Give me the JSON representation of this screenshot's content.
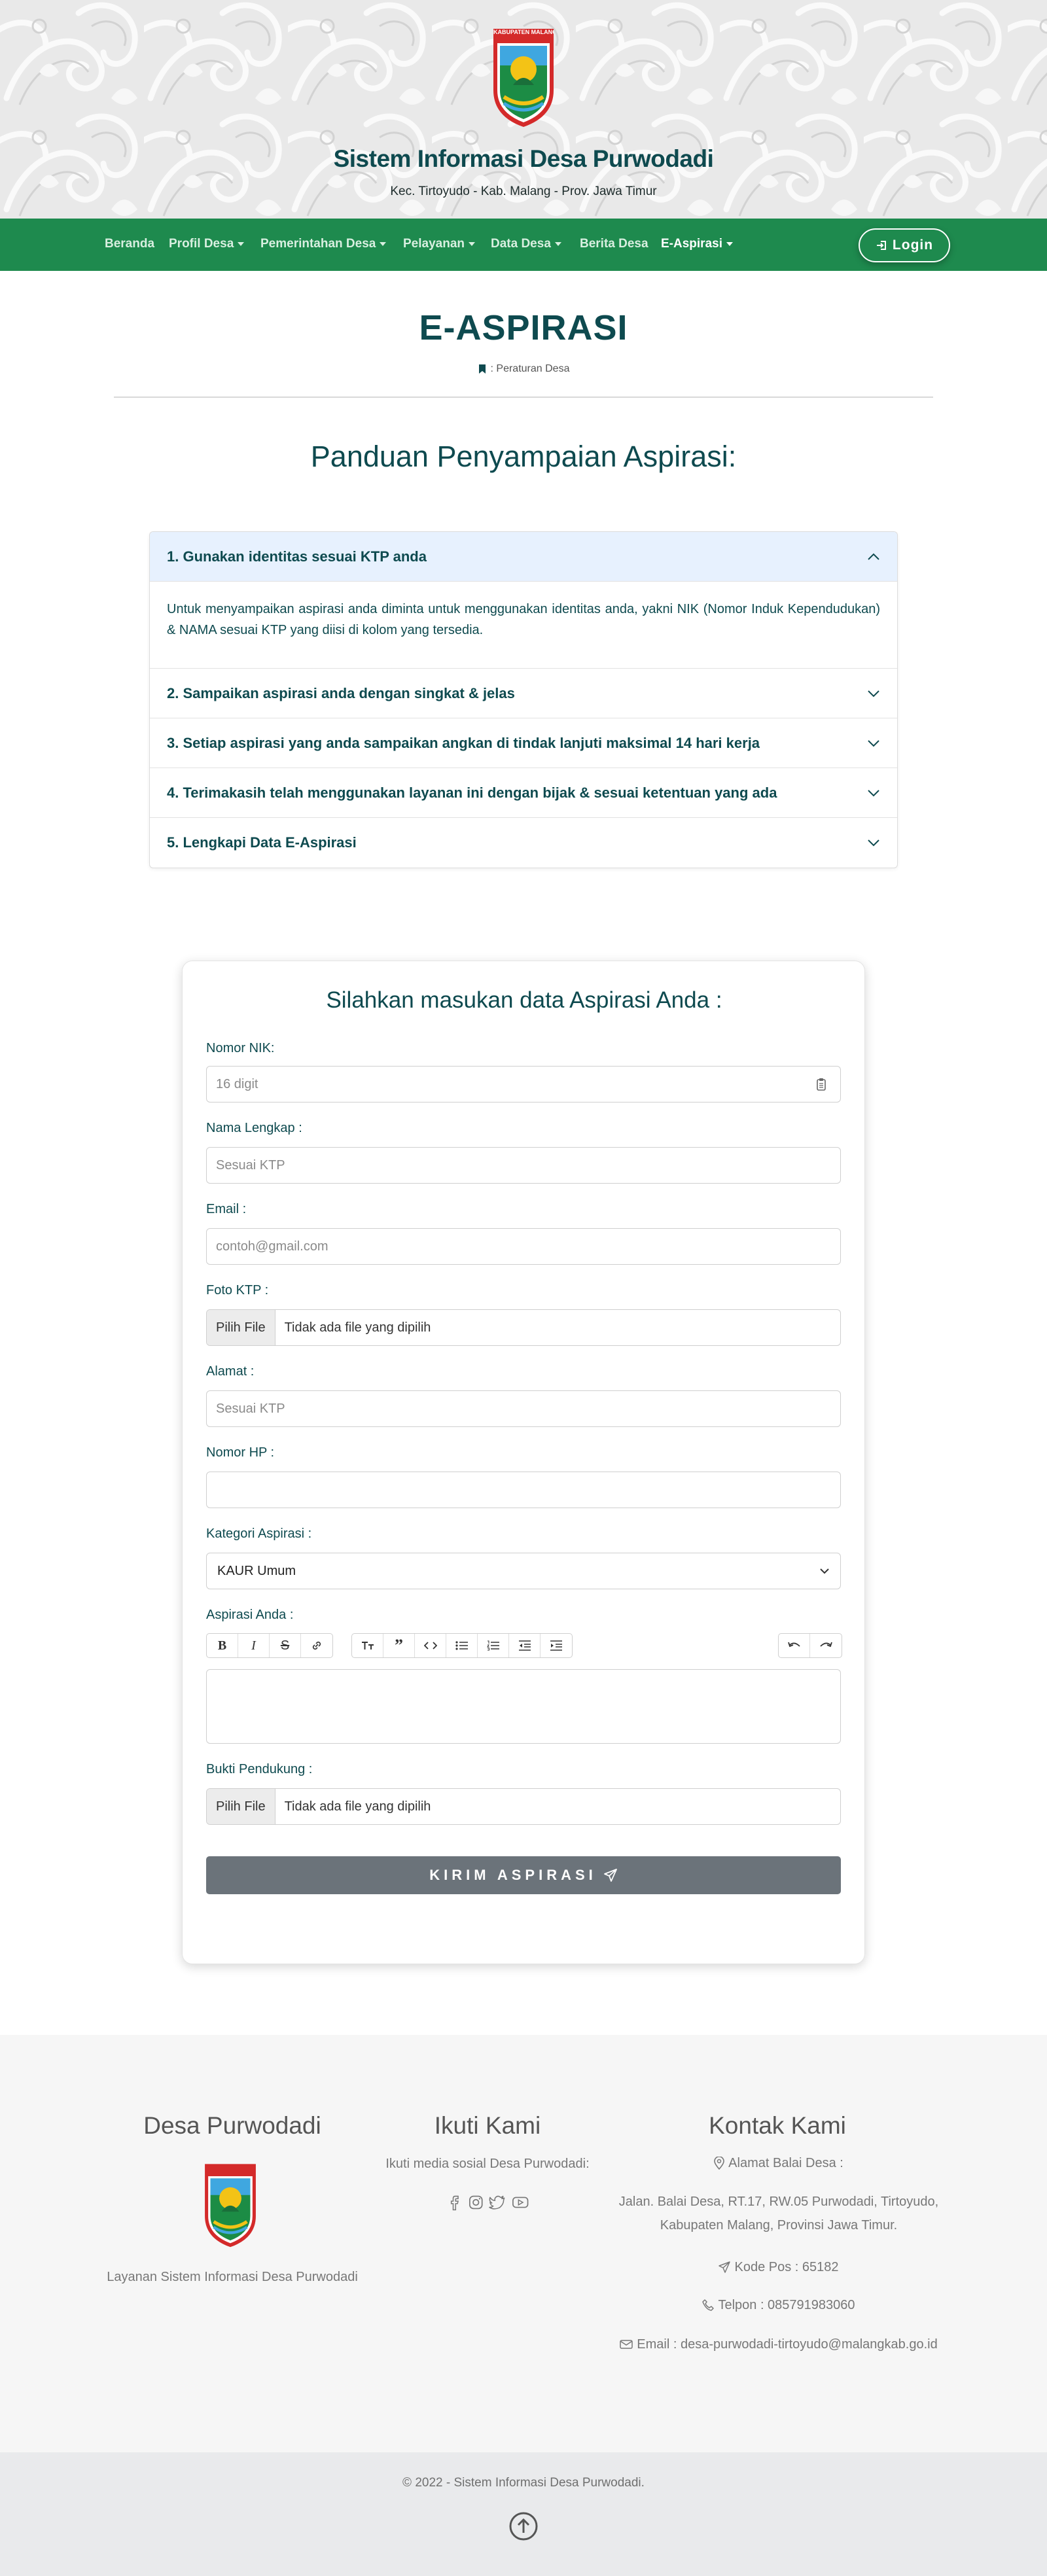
{
  "header": {
    "logo_text": "KABUPATEN MALANG",
    "title": "Sistem Informasi Desa Purwodadi",
    "subtitle": "Kec. Tirtoyudo - Kab. Malang - Prov. Jawa Timur"
  },
  "nav": {
    "items": [
      {
        "label": "Beranda",
        "dropdown": false
      },
      {
        "label": "Profil Desa",
        "dropdown": true
      },
      {
        "label": "Pemerintahan Desa",
        "dropdown": true
      },
      {
        "label": "Pelayanan",
        "dropdown": true
      },
      {
        "label": "Data Desa",
        "dropdown": true
      },
      {
        "label": "Berita Desa",
        "dropdown": false
      },
      {
        "label": "E-Aspirasi",
        "dropdown": true,
        "active": true
      }
    ],
    "login_label": "Login",
    "color": "#1e8a4e"
  },
  "page": {
    "title": "E-ASPIRASI",
    "breadcrumb": ": Peraturan Desa",
    "guide_title": "Panduan Penyampaian Aspirasi:"
  },
  "accordion": [
    {
      "title": "1. Gunakan identitas sesuai KTP anda",
      "open": true,
      "body": "Untuk menyampaikan aspirasi anda diminta untuk menggunakan identitas anda, yakni NIK (Nomor Induk Kependudukan) & NAMA sesuai KTP yang diisi di kolom yang tersedia."
    },
    {
      "title": "2. Sampaikan aspirasi anda dengan singkat & jelas",
      "open": false
    },
    {
      "title": "3. Setiap aspirasi yang anda sampaikan angkan di tindak lanjuti maksimal 14 hari kerja",
      "open": false
    },
    {
      "title": "4. Terimakasih telah menggunakan layanan ini dengan bijak & sesuai ketentuan yang ada",
      "open": false
    },
    {
      "title": "5. Lengkapi Data E-Aspirasi",
      "open": false
    }
  ],
  "form": {
    "title": "Silahkan masukan data Aspirasi Anda :",
    "nik_label": "Nomor NIK:",
    "nik_placeholder": "16 digit",
    "name_label": "Nama Lengkap :",
    "name_placeholder": "Sesuai KTP",
    "email_label": "Email :",
    "email_placeholder": "contoh@gmail.com",
    "ktp_label": "Foto KTP :",
    "file_button": "Pilih File",
    "file_none": "Tidak ada file yang dipilih",
    "address_label": "Alamat :",
    "address_placeholder": "Sesuai KTP",
    "phone_label": "Nomor HP :",
    "category_label": "Kategori Aspirasi :",
    "category_value": "KAUR Umum",
    "aspiration_label": "Aspirasi Anda :",
    "evidence_label": "Bukti Pendukung :",
    "submit_label": "KIRIM ASPIRASI",
    "submit_color": "#6b737a"
  },
  "footer": {
    "col1_title": "Desa Purwodadi",
    "col1_text": "Layanan Sistem Informasi Desa Purwodadi",
    "col2_title": "Ikuti Kami",
    "col2_text": "Ikuti media sosial Desa Purwodadi:",
    "social_icons": [
      "facebook-icon",
      "instagram-icon",
      "twitter-icon",
      "youtube-icon"
    ],
    "col3_title": "Kontak Kami",
    "address_heading": "Alamat Balai Desa :",
    "address_line1": "Jalan. Balai Desa, RT.17, RW.05 Purwodadi, Tirtoyudo,",
    "address_line2": "Kabupaten Malang, Provinsi Jawa Timur.",
    "postal": "Kode Pos : 65182",
    "phone": "Telpon : 085791983060",
    "email": "Email : desa-purwodadi-tirtoyudo@malangkab.go.id",
    "copyright": "© 2022 - Sistem Informasi Desa Purwodadi."
  }
}
